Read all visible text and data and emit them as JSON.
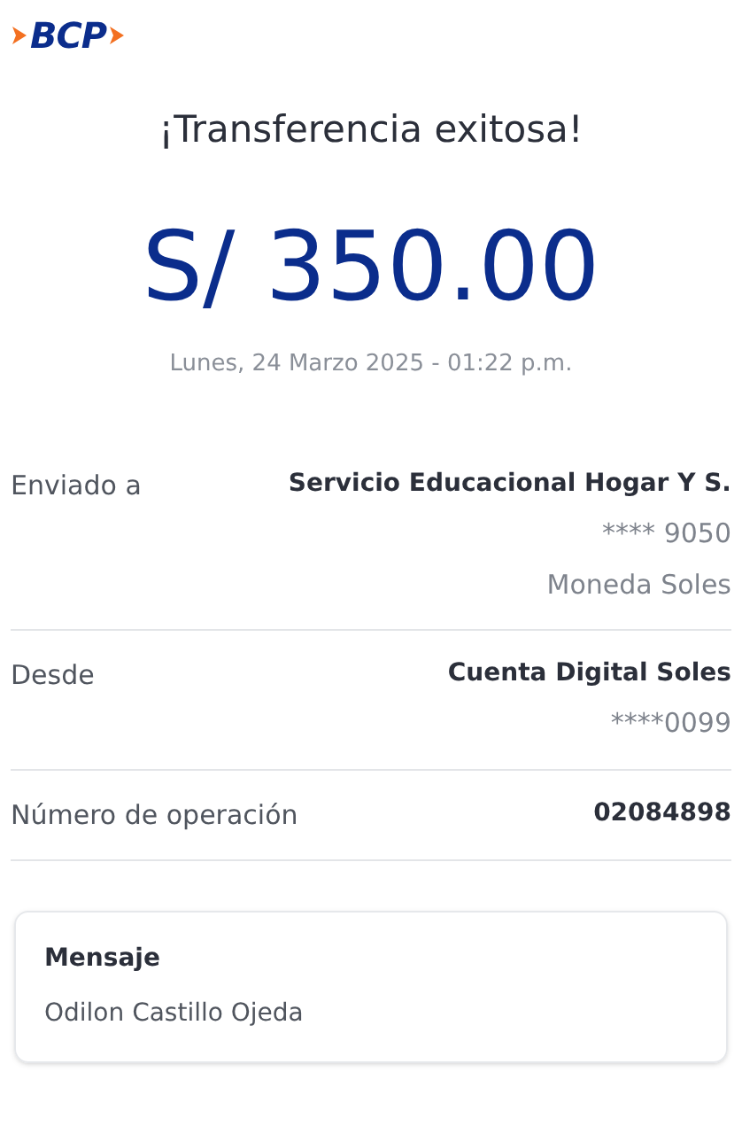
{
  "logo": {
    "text": "BCP"
  },
  "title": "¡Transferencia exitosa!",
  "amount": "S/ 350.00",
  "datetime": "Lunes, 24 Marzo 2025 - 01:22 p.m.",
  "details": [
    {
      "label": "Enviado a",
      "values": [
        "Servicio Educacional Hogar Y S.",
        "**** 9050",
        "Moneda Soles"
      ]
    },
    {
      "label": "Desde",
      "values": [
        "Cuenta Digital Soles",
        "****0099"
      ]
    },
    {
      "label": "Número de operación",
      "values": [
        "02084898"
      ]
    }
  ],
  "message": {
    "title": "Mensaje",
    "text": "Odilon Castillo Ojeda"
  }
}
